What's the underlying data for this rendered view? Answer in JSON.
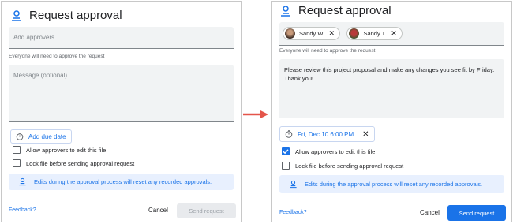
{
  "left": {
    "title": "Request approval",
    "approvers_placeholder": "Add approvers",
    "helper": "Everyone will need to approve the request",
    "message_placeholder": "Message (optional)",
    "due_label": "Add due date",
    "check_edit": "Allow approvers to edit this file",
    "check_lock": "Lock file before sending approval request",
    "info": "Edits during the approval process will reset any recorded approvals.",
    "feedback": "Feedback?",
    "cancel": "Cancel",
    "send": "Send request"
  },
  "right": {
    "title": "Request approval",
    "chips": [
      {
        "label": "Sandy W"
      },
      {
        "label": "Sandy T"
      }
    ],
    "helper": "Everyone will need to approve the request",
    "message": "Please review this project proposal and make any changes you see fit by Friday. Thank you!",
    "due_value": "Fri, Dec 10 6:00 PM",
    "check_edit": "Allow approvers to edit this file",
    "check_lock": "Lock file before sending approval request",
    "info": "Edits during the approval process will reset any recorded approvals.",
    "feedback": "Feedback?",
    "cancel": "Cancel",
    "send": "Send request"
  },
  "colors": {
    "accent": "#1a73e8",
    "info_bg": "#e8f0fe",
    "field_bg": "#f1f3f4",
    "arrow": "#e4554a",
    "disabled_btn_bg": "#e8eaed",
    "disabled_btn_text": "#9aa0a6"
  },
  "state": {
    "left_edit_checked": false,
    "left_lock_checked": false,
    "right_edit_checked": true,
    "right_lock_checked": false,
    "left_send_enabled": false,
    "right_send_enabled": true
  }
}
